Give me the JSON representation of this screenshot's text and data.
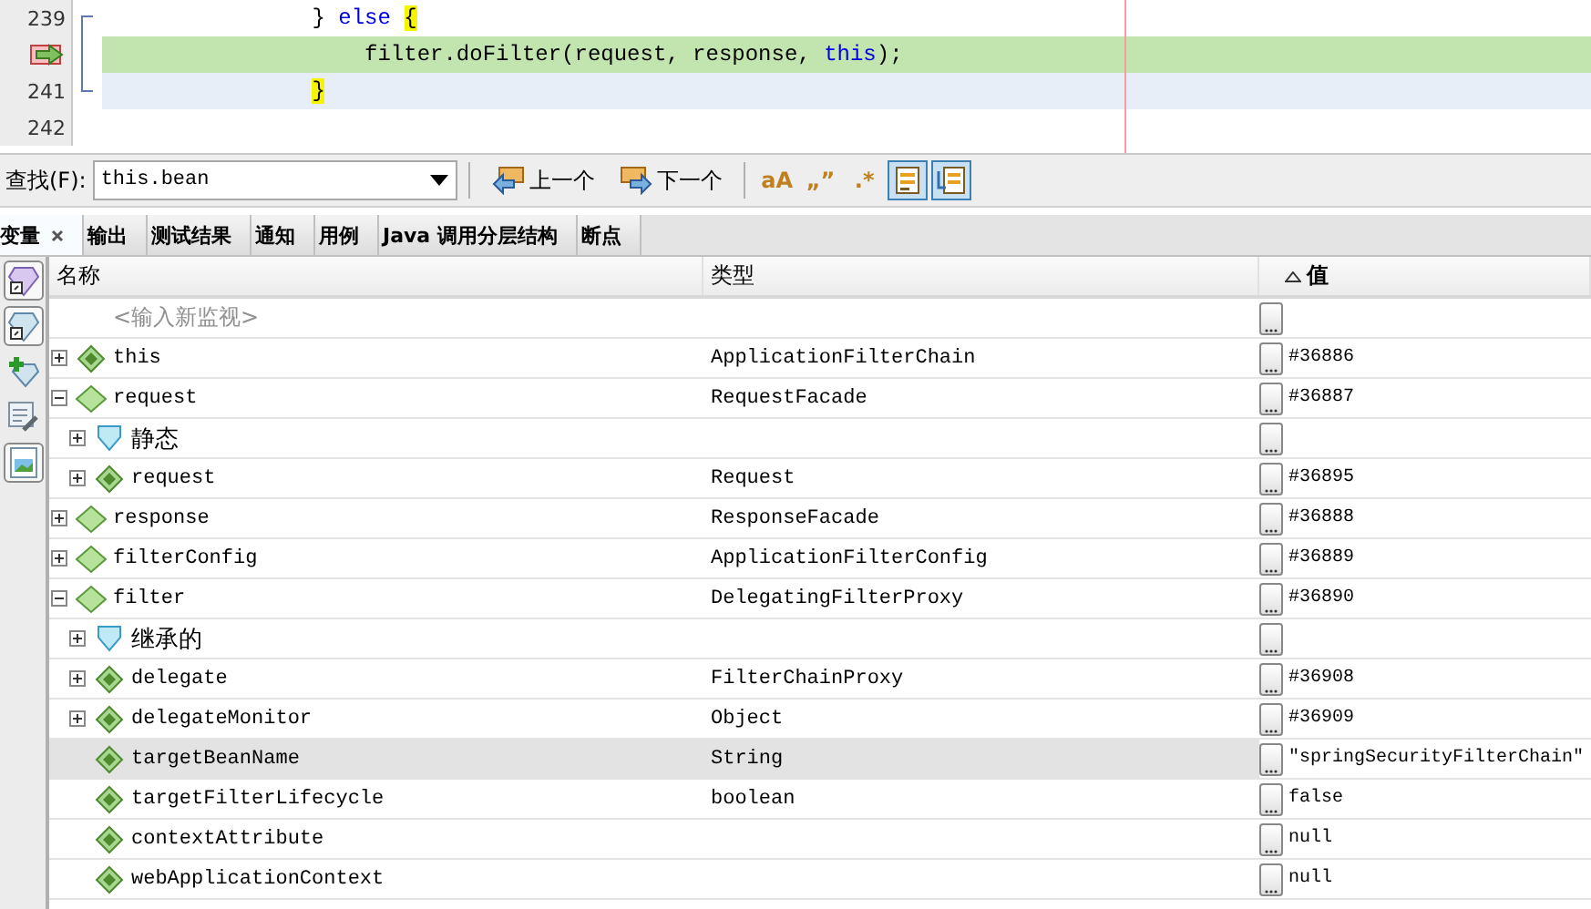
{
  "editor": {
    "lines": [
      {
        "number": "239",
        "current": false,
        "caret": false,
        "code": [
          {
            "kind": "plain",
            "text": "                } "
          },
          {
            "kind": "keyword",
            "text": "else "
          },
          {
            "kind": "brace",
            "text": "{"
          }
        ]
      },
      {
        "current": true,
        "caret": false,
        "code": [
          {
            "kind": "plain",
            "text": "                    filter.doFilter(request, response, "
          },
          {
            "kind": "keyword",
            "text": "this"
          },
          {
            "kind": "plain",
            "text": ");"
          }
        ]
      },
      {
        "number": "241",
        "current": false,
        "caret": true,
        "code": [
          {
            "kind": "brace",
            "text": "                }"
          }
        ]
      },
      {
        "number": "242",
        "current": false,
        "caret": false
      }
    ]
  },
  "find": {
    "label": "查找(F):",
    "query": "this.bean",
    "buttons": [
      {
        "kind": "previous",
        "label": "上一个"
      },
      {
        "kind": "next",
        "label": "下一个"
      }
    ],
    "options": [
      {
        "kind": "glyph",
        "glyph": "aA",
        "selected": false
      },
      {
        "kind": "glyph",
        "glyph": "„”",
        "selected": false
      },
      {
        "kind": "glyph",
        "glyph": ".*",
        "selected": false
      },
      {
        "kind": "highlight",
        "selected": true
      },
      {
        "kind": "wrap",
        "selected": true
      }
    ]
  },
  "tabs": [
    {
      "label": "变量",
      "selected": true,
      "closable": true
    },
    {
      "label": "输出",
      "selected": false,
      "closable": false
    },
    {
      "label": "测试结果",
      "selected": false,
      "closable": false
    },
    {
      "label": "通知",
      "selected": false,
      "closable": false
    },
    {
      "label": "用例",
      "selected": false,
      "closable": false
    },
    {
      "label": "Java 调用分层结构",
      "selected": false,
      "closable": false
    },
    {
      "label": "断点",
      "selected": false,
      "closable": false
    }
  ],
  "toolbar": [
    {
      "kind": "gem-violet",
      "selected": true
    },
    {
      "kind": "gem-blue",
      "selected": true
    },
    {
      "kind": "gem-add",
      "selected": false
    },
    {
      "kind": "tools",
      "selected": false
    },
    {
      "kind": "picture",
      "selected": true
    }
  ],
  "variables": {
    "columns": [
      {
        "label": "名称",
        "sorted": false
      },
      {
        "label": "类型",
        "sorted": false
      },
      {
        "label": "值",
        "sorted": true
      }
    ],
    "rows": [
      {
        "kind": "watch",
        "name": "<输入新监视>",
        "selected": false
      },
      {
        "kind": "field",
        "name": "this",
        "type": "ApplicationFilterChain",
        "value": "#36886",
        "expanded": false,
        "selected": false
      },
      {
        "kind": "local",
        "name": "request",
        "type": "RequestFacade",
        "value": "#36887",
        "expanded": true,
        "selected": false,
        "children": [
          {
            "kind": "category",
            "name": "静态",
            "expanded": false,
            "selected": false
          },
          {
            "kind": "field",
            "name": "request",
            "type": "Request",
            "value": "#36895",
            "expanded": false,
            "selected": false
          }
        ]
      },
      {
        "kind": "local",
        "name": "response",
        "type": "ResponseFacade",
        "value": "#36888",
        "expanded": false,
        "selected": false
      },
      {
        "kind": "local",
        "name": "filterConfig",
        "type": "ApplicationFilterConfig",
        "value": "#36889",
        "expanded": false,
        "selected": false
      },
      {
        "kind": "local",
        "name": "filter",
        "type": "DelegatingFilterProxy",
        "value": "#36890",
        "expanded": true,
        "selected": false,
        "children": [
          {
            "kind": "category",
            "name": "继承的",
            "expanded": false,
            "selected": false
          },
          {
            "kind": "field",
            "name": "delegate",
            "type": "FilterChainProxy",
            "value": "#36908",
            "expanded": false,
            "selected": false
          },
          {
            "kind": "field",
            "name": "delegateMonitor",
            "type": "Object",
            "value": "#36909",
            "expanded": false,
            "selected": false
          },
          {
            "kind": "field",
            "name": "targetBeanName",
            "type": "String",
            "value": "\"springSecurityFilterChain\"",
            "selected": true
          },
          {
            "kind": "field",
            "name": "targetFilterLifecycle",
            "type": "boolean",
            "value": "false",
            "selected": false
          },
          {
            "kind": "field",
            "name": "contextAttribute",
            "value": "null",
            "selected": false
          },
          {
            "kind": "field",
            "name": "webApplicationContext",
            "value": "null",
            "selected": false
          }
        ]
      }
    ]
  }
}
